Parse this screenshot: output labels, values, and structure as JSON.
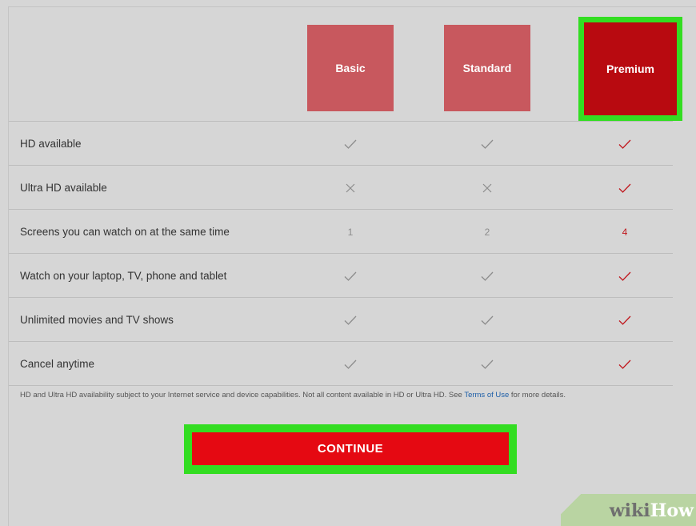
{
  "plans": [
    {
      "name": "Basic"
    },
    {
      "name": "Standard"
    },
    {
      "name": "Premium"
    }
  ],
  "features": [
    {
      "label": "HD available",
      "values": [
        "check",
        "check",
        "check"
      ]
    },
    {
      "label": "Ultra HD available",
      "values": [
        "cross",
        "cross",
        "check"
      ]
    },
    {
      "label": "Screens you can watch on at the same time",
      "values": [
        "1",
        "2",
        "4"
      ]
    },
    {
      "label": "Watch on your laptop, TV, phone and tablet",
      "values": [
        "check",
        "check",
        "check"
      ]
    },
    {
      "label": "Unlimited movies and TV shows",
      "values": [
        "check",
        "check",
        "check"
      ]
    },
    {
      "label": "Cancel anytime",
      "values": [
        "check",
        "check",
        "check"
      ]
    }
  ],
  "footnote": {
    "before": "HD and Ultra HD availability subject to your Internet service and device capabilities. Not all content available in HD or Ultra HD. See ",
    "link": "Terms of Use",
    "after": " for more details."
  },
  "continue_label": "CONTINUE",
  "watermark": {
    "part1": "wiki",
    "part2": "How"
  },
  "colors": {
    "background": "#d6d6d6",
    "plan_unselected": "#c8585e",
    "plan_selected": "#b80a10",
    "highlight": "#33dd22",
    "cta": "#e50912",
    "check_inactive": "#8c8c8c",
    "check_active": "#c0171d",
    "link": "#1e5fa8"
  }
}
